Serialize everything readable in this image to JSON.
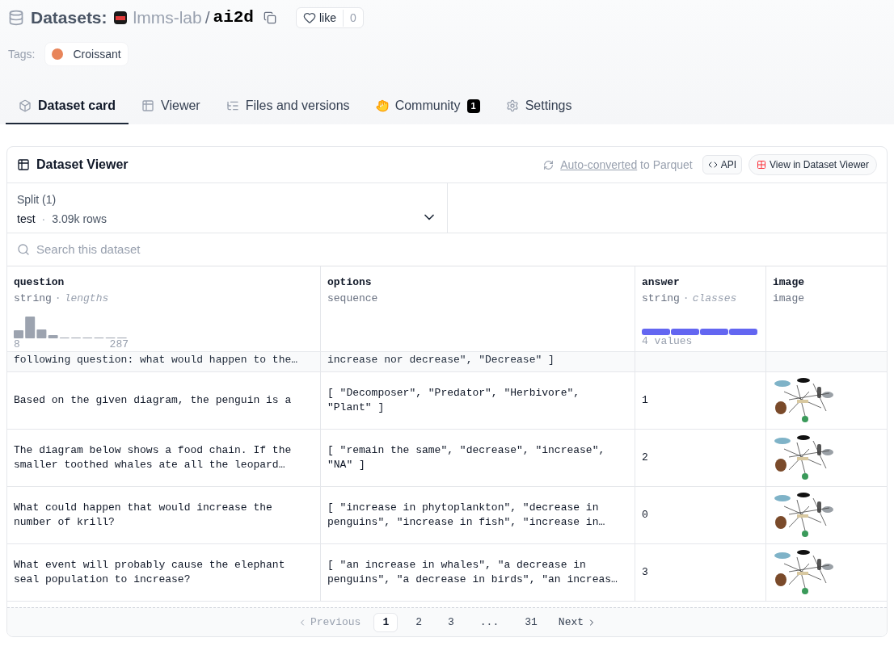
{
  "header": {
    "section": "Datasets:",
    "owner": "lmms-lab",
    "separator": "/",
    "name": "ai2d",
    "like_label": "like",
    "like_count": "0"
  },
  "tags": {
    "label": "Tags:",
    "items": [
      {
        "label": "Croissant"
      }
    ]
  },
  "tabs": [
    {
      "label": "Dataset card",
      "selected": true
    },
    {
      "label": "Viewer",
      "selected": false
    },
    {
      "label": "Files and versions",
      "selected": false
    },
    {
      "label": "Community",
      "selected": false,
      "badge": "1"
    },
    {
      "label": "Settings",
      "selected": false
    }
  ],
  "viewer": {
    "title": "Dataset Viewer",
    "converted_link": "Auto-converted",
    "converted_rest": "to Parquet",
    "api_button": "API",
    "view_button": "View in Dataset Viewer",
    "split": {
      "label": "Split (1)",
      "value": "test",
      "dot": "·",
      "rows": "3.09k rows"
    },
    "search": {
      "placeholder": "Search this dataset"
    },
    "columns": [
      {
        "name": "question",
        "type": "string",
        "dot": "·",
        "stat": "lengths",
        "kind": "histogram",
        "min": "8",
        "max": "287"
      },
      {
        "name": "options",
        "type": "sequence",
        "kind": "plain"
      },
      {
        "name": "answer",
        "type": "string",
        "dot": "·",
        "stat": "classes",
        "kind": "classes",
        "summary": "4 values"
      },
      {
        "name": "image",
        "type": "image",
        "kind": "plain"
      }
    ],
    "partial_row": {
      "question": "following question: what would happen to the…",
      "options": "increase nor decrease\", \"Decrease\" ]"
    },
    "rows": [
      {
        "question": "Based on the given diagram, the penguin is a",
        "options": "[ \"Decomposer\", \"Predator\", \"Herbivore\", \"Plant\" ]",
        "answer": "1"
      },
      {
        "question": "The diagram below shows a food chain. If the smaller toothed whales ate all the leopard…",
        "options": "[ \"remain the same\", \"decrease\", \"increase\", \"NA\" ]",
        "answer": "2"
      },
      {
        "question": "What could happen that would increase the number of krill?",
        "options": "[ \"increase in phytoplankton\", \"decrease in penguins\", \"increase in fish\", \"increase in…",
        "answer": "0"
      },
      {
        "question": "What event will probably cause the elephant seal population to increase?",
        "options": "[ \"an increase in whales\", \"a decrease in penguins\", \"a decrease in birds\", \"an increas…",
        "answer": "3"
      }
    ],
    "pagination": {
      "previous": "Previous",
      "next": "Next",
      "pages": [
        {
          "label": "1",
          "selected": true
        },
        {
          "label": "2",
          "selected": false
        },
        {
          "label": "3",
          "selected": false
        },
        {
          "label": "...",
          "selected": false
        },
        {
          "label": "31",
          "selected": false
        }
      ]
    }
  }
}
